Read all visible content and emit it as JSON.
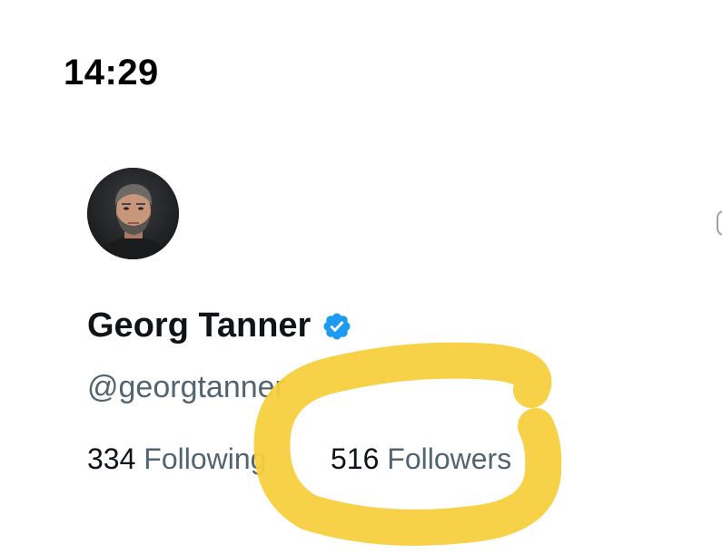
{
  "status_bar": {
    "time": "14:29"
  },
  "profile": {
    "display_name": "Georg Tanner",
    "handle": "@georgtanner",
    "verified_icon": "verified-badge-icon",
    "avatar_icon": "avatar-photo"
  },
  "stats": {
    "following_count": "334",
    "following_label": "Following",
    "followers_count": "516",
    "followers_label": "Followers"
  },
  "colors": {
    "text_primary": "#0f1419",
    "text_secondary": "#536471",
    "verified_blue": "#1d9bf0",
    "highlight_yellow": "#f7cf3e"
  }
}
